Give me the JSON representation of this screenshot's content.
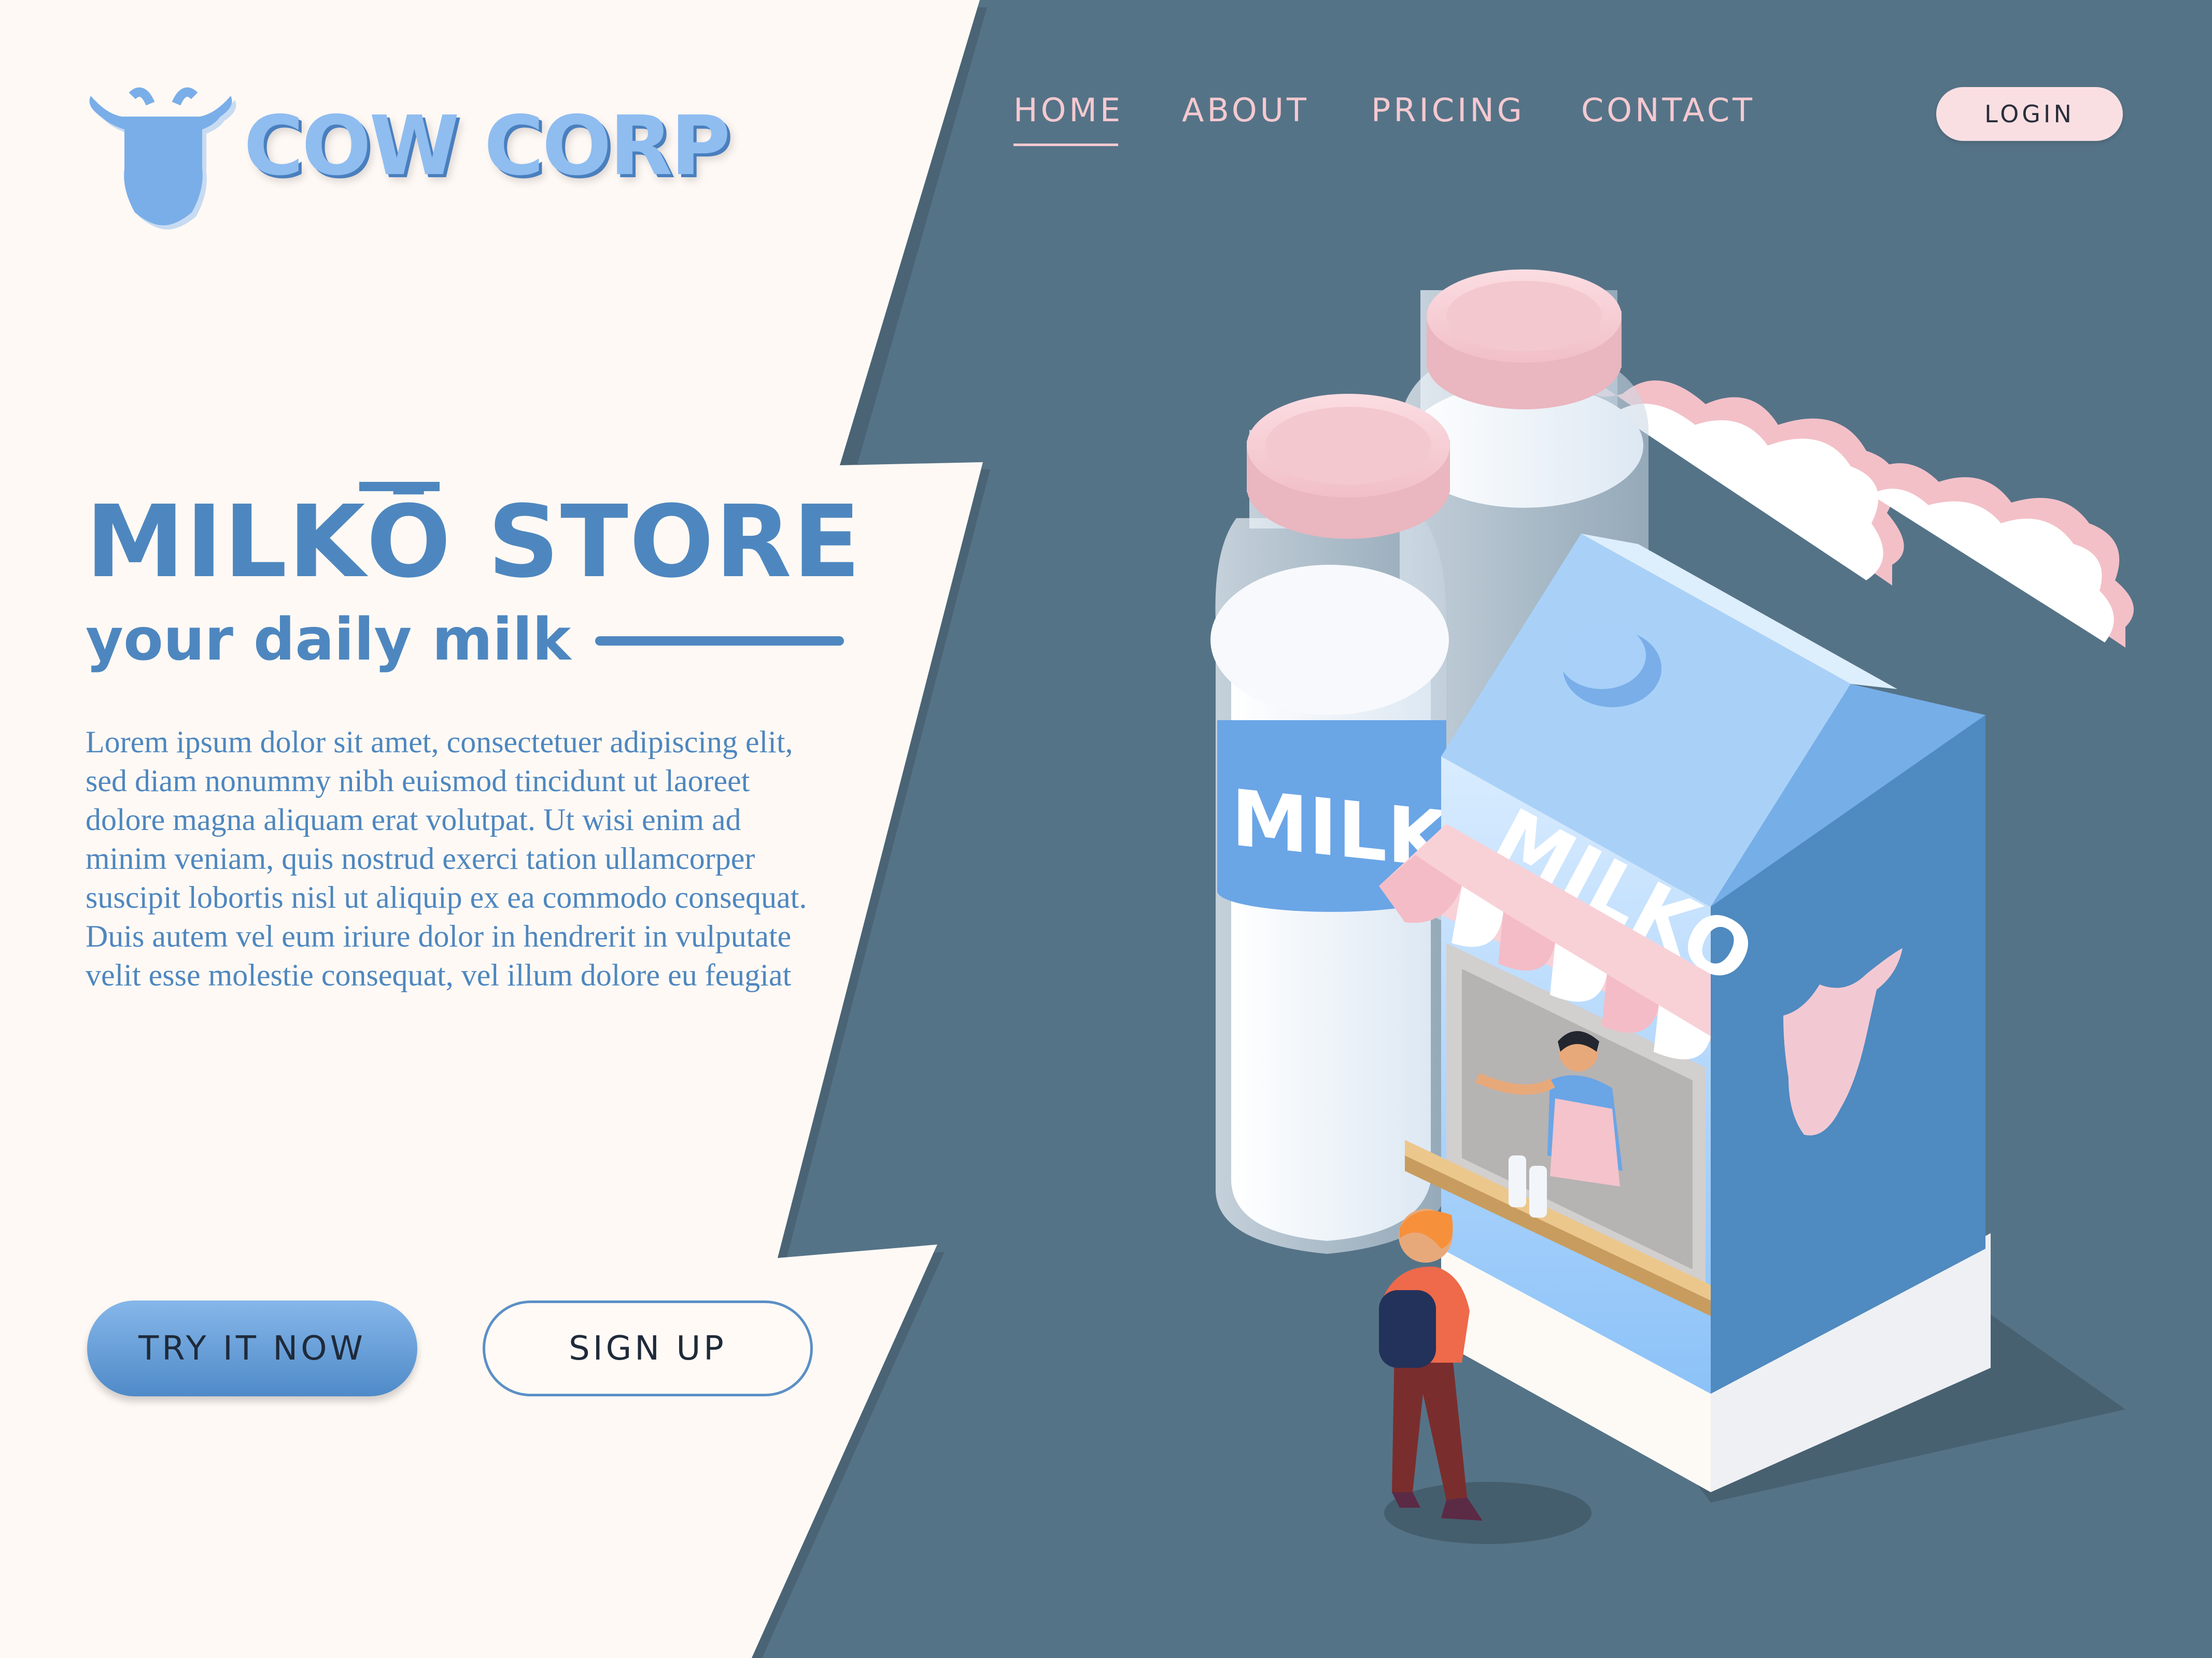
{
  "brand": {
    "name": "COW CORP",
    "logo_icon": "cow-head-icon"
  },
  "nav": {
    "items": [
      {
        "label": "HOME",
        "active": true
      },
      {
        "label": "ABOUT",
        "active": false
      },
      {
        "label": "PRICING",
        "active": false
      },
      {
        "label": "CONTACT",
        "active": false
      }
    ],
    "login_label": "LOGIN"
  },
  "hero": {
    "title": "MILKŌ STORE",
    "tagline": "your daily milk",
    "body_lines": [
      "Lorem ipsum dolor sit amet, consectetuer adipiscing elit,",
      "sed diam nonummy nibh euismod tincidunt ut laoreet",
      "dolore magna aliquam erat volutpat. Ut wisi enim ad",
      "minim veniam, quis nostrud exerci tation ullamcorper",
      "suscipit lobortis nisl ut aliquip ex ea commodo consequat.",
      "Duis autem vel eum iriure dolor in hendrerit in vulputate",
      "velit esse molestie consequat, vel illum dolore eu feugiat"
    ],
    "primary_button": "TRY IT NOW",
    "secondary_button": "SIGN UP"
  },
  "illustration": {
    "bottle_label": "MILKO",
    "carton_label": "MILKO"
  },
  "colors": {
    "accent_blue": "#4e87bf",
    "panel_cream": "#fff9f5",
    "background_slate": "#557387",
    "pink": "#f5c9d0"
  }
}
